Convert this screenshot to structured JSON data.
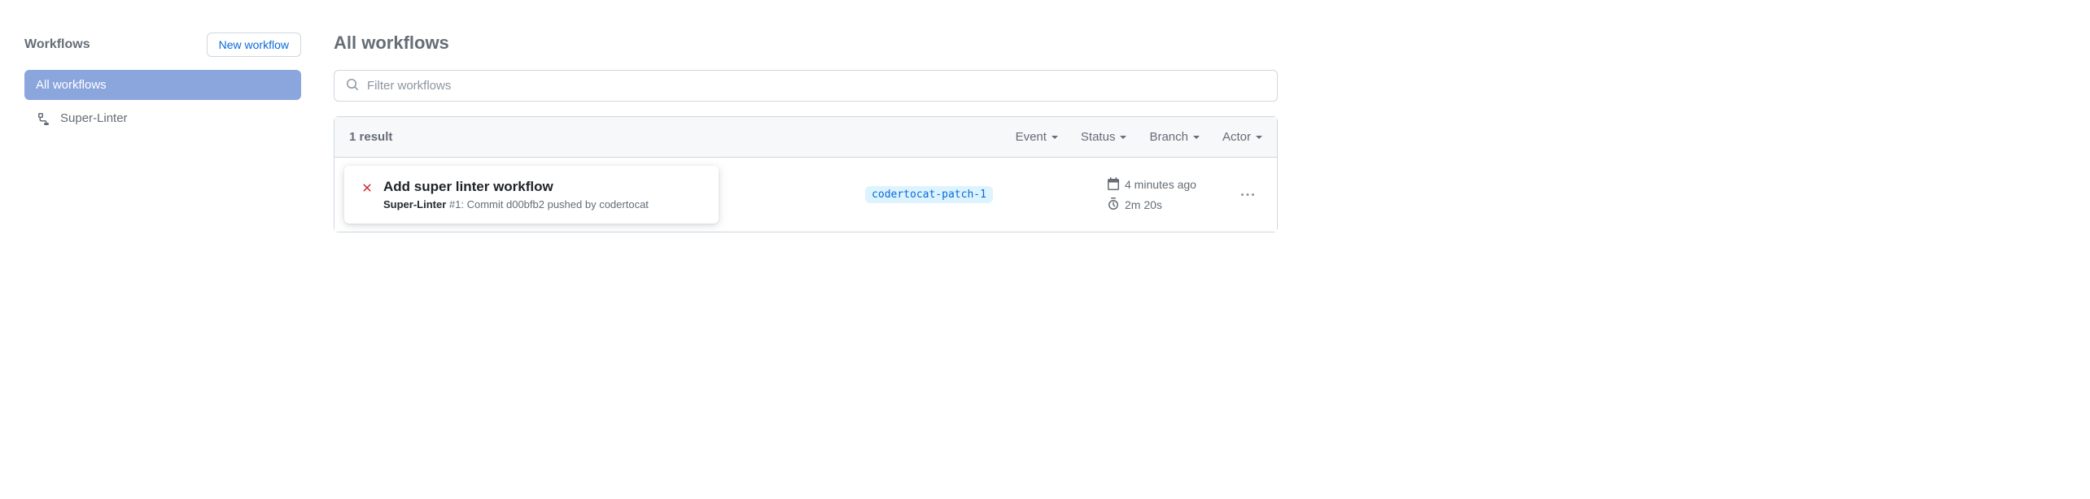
{
  "sidebar": {
    "title": "Workflows",
    "new_button_label": "New workflow",
    "items": [
      {
        "label": "All workflows"
      },
      {
        "label": "Super-Linter"
      }
    ]
  },
  "main": {
    "title": "All workflows",
    "filter_placeholder": "Filter workflows",
    "result_count_label": "1 result",
    "filters": [
      {
        "label": "Event"
      },
      {
        "label": "Status"
      },
      {
        "label": "Branch"
      },
      {
        "label": "Actor"
      }
    ]
  },
  "run": {
    "title": "Add super linter workflow",
    "workflow_name": "Super-Linter",
    "run_number_prefix": " #1: ",
    "description_prefix": "Commit d00bfb2 pushed by ",
    "actor": "codertocat",
    "branch": "codertocat-patch-1",
    "timestamp": "4 minutes ago",
    "duration": "2m 20s"
  }
}
